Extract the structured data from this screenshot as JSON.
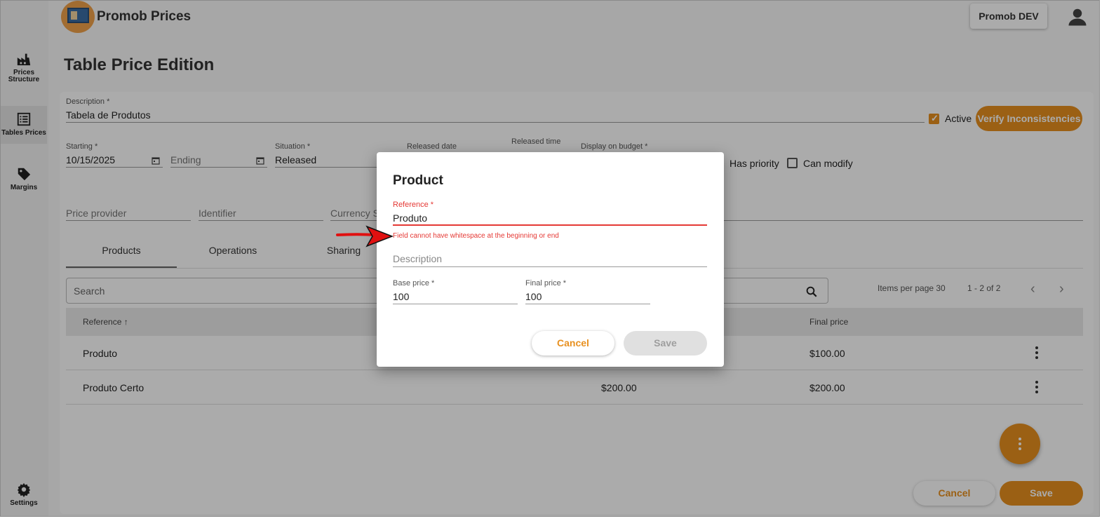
{
  "app": {
    "title": "Promob Prices",
    "environment": "Promob DEV"
  },
  "sidebar": {
    "items": [
      {
        "label_line1": "Prices",
        "label_line2": "Structure",
        "icon": "factory-icon"
      },
      {
        "label_line1": "Tables Prices",
        "icon": "list-icon"
      },
      {
        "label_line1": "Margins",
        "icon": "tag-icon"
      },
      {
        "label_line1": "Settings",
        "icon": "gear-icon"
      }
    ]
  },
  "page": {
    "title": "Table Price Edition"
  },
  "form": {
    "description_label": "Description *",
    "description_value": "Tabela de Produtos",
    "active_label": "Active",
    "verify_button": "Verify Inconsistencies",
    "starting_label": "Starting *",
    "starting_value": "10/15/2025",
    "ending_placeholder": "Ending",
    "situation_label": "Situation *",
    "situation_value": "Released",
    "released_date_label": "Released date",
    "released_time_label": "Released time",
    "display_budget_label": "Display on budget *",
    "has_priority_label": "Has priority",
    "can_modify_label": "Can modify",
    "price_provider_placeholder": "Price provider",
    "identifier_placeholder": "Identifier",
    "currency_placeholder": "Currency S"
  },
  "tabs": [
    "Products",
    "Operations",
    "Sharing"
  ],
  "table": {
    "search_placeholder": "Search",
    "items_per_page": "Items per page 30",
    "range": "1 - 2 of 2",
    "col_reference": "Reference",
    "col_final_price": "Final price",
    "rows": [
      {
        "reference": "Produto",
        "base_price": "",
        "final_price": "$100.00"
      },
      {
        "reference": "Produto Certo",
        "base_price": "$200.00",
        "final_price": "$200.00"
      }
    ]
  },
  "footer": {
    "cancel": "Cancel",
    "save": "Save"
  },
  "dialog": {
    "title": "Product",
    "reference_label": "Reference *",
    "reference_value": "Produto",
    "reference_error": "Field cannot have whitespace at the beginning or end",
    "description_placeholder": "Description",
    "base_price_label": "Base price *",
    "base_price_value": "100",
    "final_price_label": "Final price *",
    "final_price_value": "100",
    "cancel": "Cancel",
    "save": "Save"
  },
  "colors": {
    "accent": "#e8901f",
    "error": "#e53935"
  }
}
